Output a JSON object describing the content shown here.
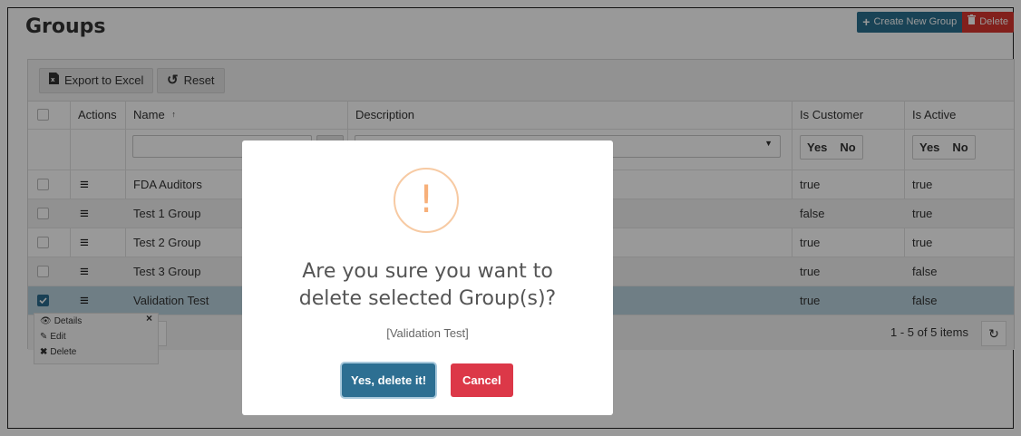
{
  "page": {
    "title": "Groups"
  },
  "top_buttons": {
    "create_label": "Create New Group",
    "delete_label": "Delete"
  },
  "toolbar": {
    "export_label": "Export to Excel",
    "reset_label": "Reset"
  },
  "columns": {
    "actions": "Actions",
    "name": "Name",
    "name_sort": "↑",
    "description": "Description",
    "is_customer": "Is Customer",
    "is_active": "Is Active"
  },
  "filters": {
    "yes": "Yes",
    "no": "No"
  },
  "rows": [
    {
      "name": "FDA Auditors",
      "is_customer": "true",
      "is_active": "true",
      "checked": false
    },
    {
      "name": "Test 1 Group",
      "is_customer": "false",
      "is_active": "true",
      "checked": false
    },
    {
      "name": "Test 2 Group",
      "is_customer": "true",
      "is_active": "true",
      "checked": false
    },
    {
      "name": "Test 3 Group",
      "is_customer": "true",
      "is_active": "false",
      "checked": false
    },
    {
      "name": "Validation Test",
      "is_customer": "true",
      "is_active": "false",
      "checked": true
    }
  ],
  "context_menu": {
    "details": "Details",
    "edit": "Edit",
    "delete": "Delete",
    "close": "×"
  },
  "pager": {
    "info": "1 - 5 of 5 items"
  },
  "modal": {
    "icon": "!",
    "title_line1": "Are you sure you want to",
    "title_line2": "delete selected Group(s)?",
    "subtitle": "[Validation Test]",
    "confirm_label": "Yes, delete it!",
    "cancel_label": "Cancel"
  },
  "colors": {
    "primary": "#2a7090",
    "danger": "#d9362f",
    "warning": "#f7b07a",
    "selected_row": "#b9d3de"
  }
}
